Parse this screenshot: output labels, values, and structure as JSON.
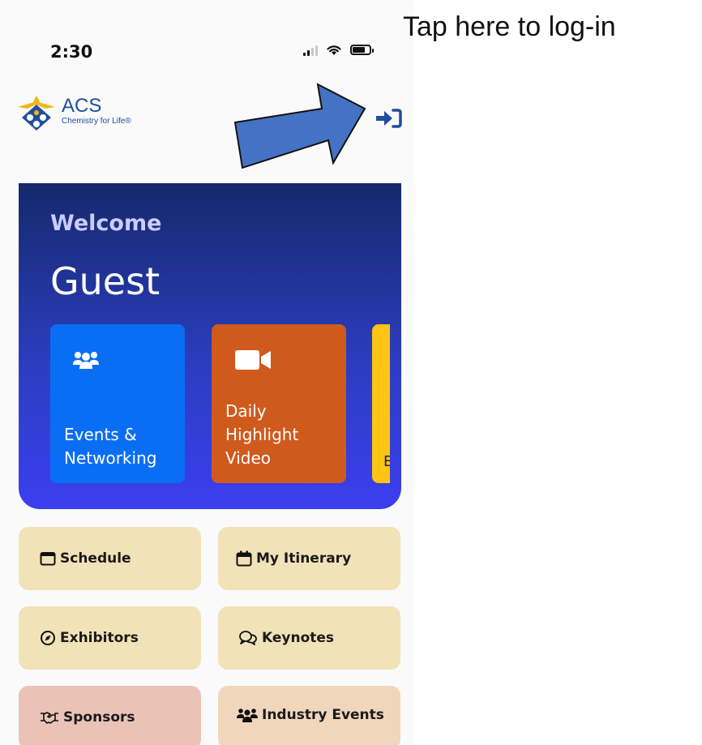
{
  "status_bar": {
    "time": "2:30"
  },
  "header": {
    "logo": {
      "name": "ACS",
      "tagline": "Chemistry for Life®"
    },
    "login_icon": "login-icon"
  },
  "hero": {
    "welcome": "Welcome",
    "user_name": "Guest",
    "cards": [
      {
        "label_line1": "Events &",
        "label_line2": "Networking",
        "icon": "people-group-icon",
        "color": "#0a6ef5"
      },
      {
        "label_line1": "Daily",
        "label_line2": "Highlight",
        "label_line3": "Video",
        "icon": "video-camera-icon",
        "color": "#d05a1c"
      },
      {
        "label_partial": "E",
        "color": "#ffc414"
      }
    ]
  },
  "menu": {
    "schedule": "Schedule",
    "itinerary": "My Itinerary",
    "exhibitors": "Exhibitors",
    "keynotes": "Keynotes",
    "sponsors": "Sponsors",
    "industry_events": "Industry Events"
  },
  "annotation": {
    "hint": "Tap here to log-in"
  },
  "colors": {
    "hero_top": "#15296b",
    "hero_bottom": "#3b3ff0",
    "tile_beige": "#f2e2b8",
    "tile_pink": "#ebc3b6",
    "arrow_fill": "#4472c4",
    "login_icon": "#1f4e9c"
  }
}
